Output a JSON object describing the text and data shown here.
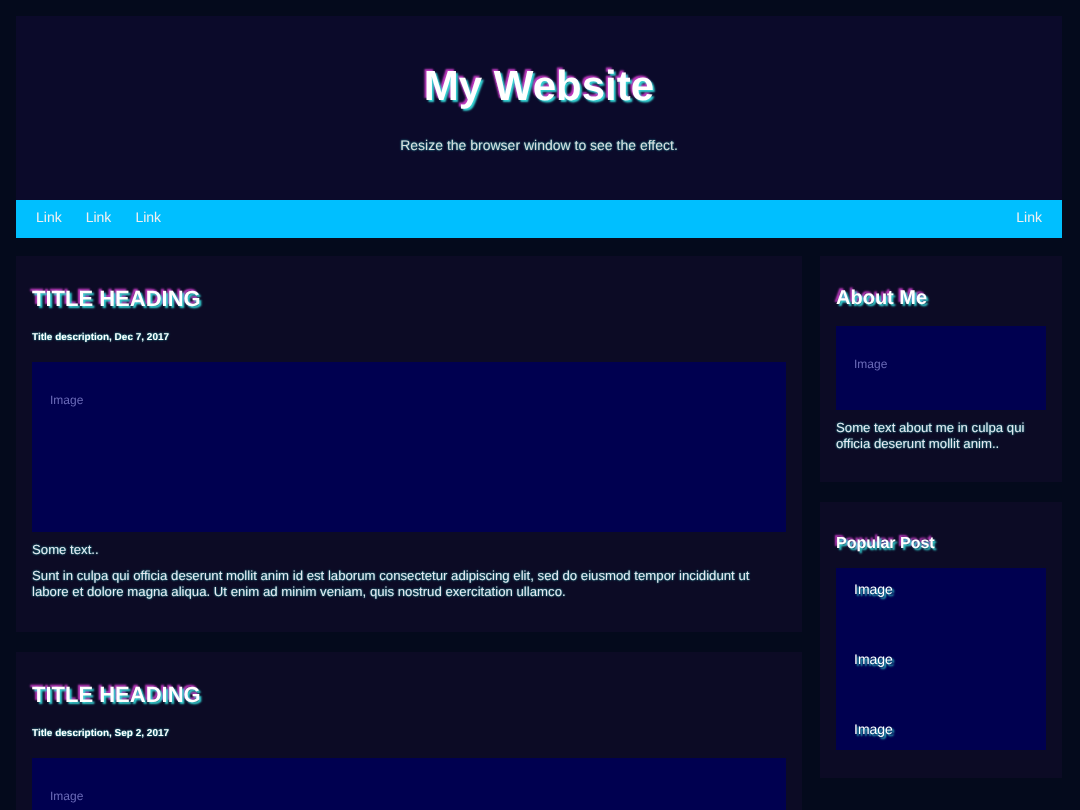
{
  "header": {
    "title": "My Website",
    "subtitle": "Resize the browser window to see the effect."
  },
  "nav": {
    "links": [
      "Link",
      "Link",
      "Link"
    ],
    "right_link": "Link"
  },
  "posts": [
    {
      "title": "TITLE HEADING",
      "description": "Title description, Dec 7, 2017",
      "image_label": "Image",
      "text": "Some text..",
      "body": "Sunt in culpa qui officia deserunt mollit anim id est laborum consectetur adipiscing elit, sed do eiusmod tempor incididunt ut labore et dolore magna aliqua. Ut enim ad minim veniam, quis nostrud exercitation ullamco."
    },
    {
      "title": "TITLE HEADING",
      "description": "Title description, Sep 2, 2017",
      "image_label": "Image"
    }
  ],
  "about": {
    "title": "About Me",
    "image_label": "Image",
    "text": "Some text about me in culpa qui officia deserunt mollit anim.."
  },
  "popular": {
    "title": "Popular Post",
    "images": [
      "Image",
      "Image",
      "Image"
    ]
  }
}
